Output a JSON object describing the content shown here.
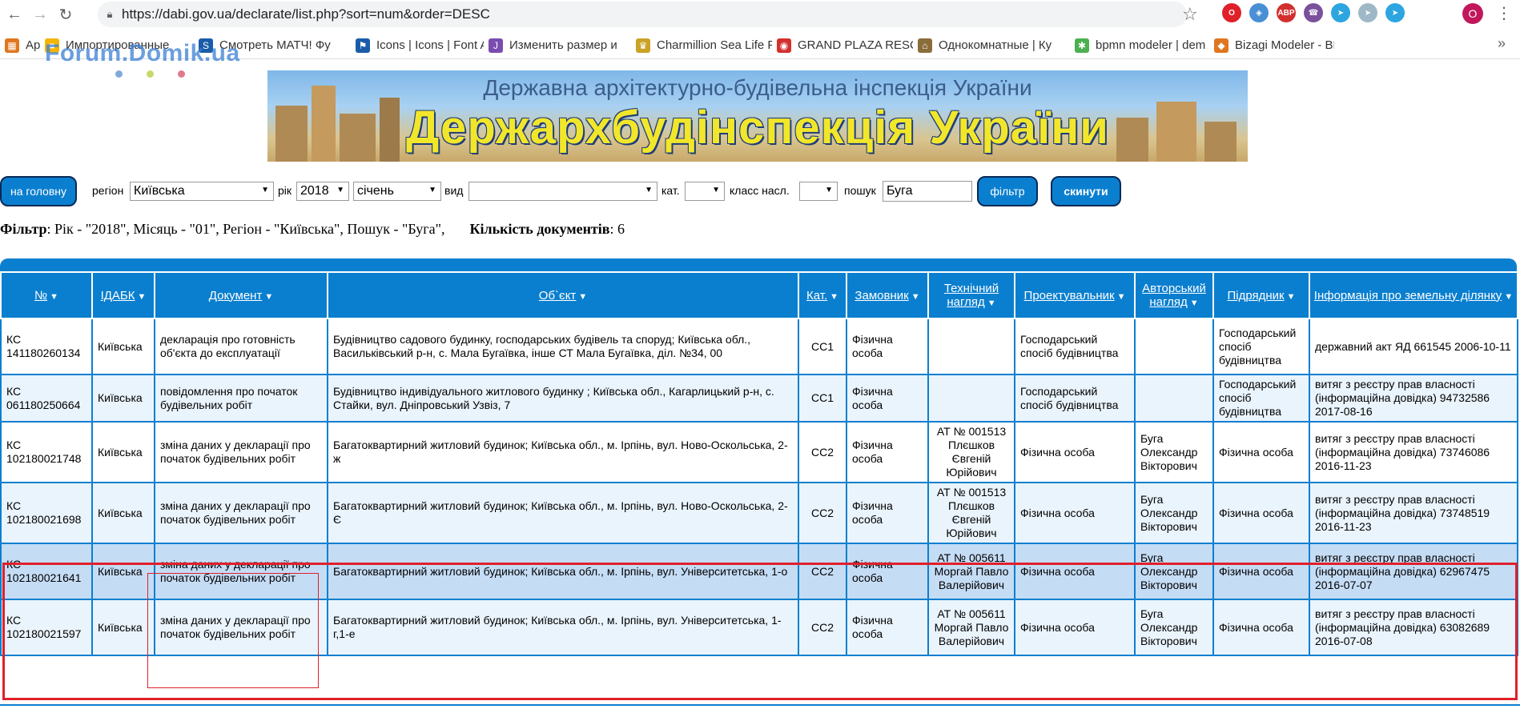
{
  "browser": {
    "url": "https://dabi.gov.ua/declarate/list.php?sort=num&order=DESC",
    "profile_initial": "O",
    "extensions": [
      {
        "name": "opera-icon",
        "color": "#e0202a",
        "label": "O"
      },
      {
        "name": "extension-icon",
        "color": "#4a8fd4",
        "label": "◈"
      },
      {
        "name": "adblock-icon",
        "color": "#d32f2f",
        "label": "ABP"
      },
      {
        "name": "viber-icon",
        "color": "#7b519d",
        "label": "☎"
      },
      {
        "name": "telegram-icon",
        "color": "#2ca5e0",
        "label": "➤"
      },
      {
        "name": "telegram-outline-icon",
        "color": "#9fb8c8",
        "label": "➤"
      },
      {
        "name": "telegram-blue-icon",
        "color": "#2ca5e0",
        "label": "➤"
      }
    ],
    "bookmarks": [
      {
        "label": "Apps",
        "icon_color": "#e0761f",
        "icon": "▦"
      },
      {
        "label": "Импортированные",
        "icon_color": "#f5b400",
        "icon": "■"
      },
      {
        "label": "Смотреть МАТЧ! Фу",
        "icon_color": "#1a5ca8",
        "icon": "S"
      },
      {
        "label": "Icons | Icons | Font A",
        "icon_color": "#1a5ca8",
        "icon": "⚑"
      },
      {
        "label": "Изменить размер и",
        "icon_color": "#7b4cb0",
        "icon": "J"
      },
      {
        "label": "Charmillion Sea Life F",
        "icon_color": "#c9a227",
        "icon": "♛"
      },
      {
        "label": "GRAND PLAZA RESO",
        "icon_color": "#d32f2f",
        "icon": "◉"
      },
      {
        "label": "Однокомнатные | Ку",
        "icon_color": "#8a6d3b",
        "icon": "⌂"
      },
      {
        "label": "bpmn modeler | dem",
        "icon_color": "#4caf50",
        "icon": "✱"
      },
      {
        "label": "Bizagi Modeler - BPM",
        "icon_color": "#e0761f",
        "icon": "◆"
      }
    ]
  },
  "watermark": "Forum.Domik.ua",
  "banner": {
    "subtitle": "Державна архітектурно-будівельна інспекція України",
    "title": "Держархбудінспекція України"
  },
  "filters": {
    "home_button": "на головну",
    "region_label": "регіон",
    "region_value": "Київська",
    "year_label": "рік",
    "year_value": "2018",
    "month_value": "січень",
    "type_label": "вид",
    "type_value": "",
    "category_label": "кат.",
    "category_value": "",
    "class_label": "класс насл.",
    "class_value": "",
    "search_label": "пошук",
    "search_value": "Буга",
    "filter_button": "фільтр",
    "reset_button": "скинути"
  },
  "summary": {
    "filter_label": "Фільтр",
    "filter_text": ": Рік - \"2018\", Місяць - \"01\", Регіон - \"Київська\", Пошук - \"Буга\",",
    "count_label": "Кількість документів",
    "count_value": ": 6"
  },
  "table": {
    "columns": [
      "№",
      "ІДАБК",
      "Документ",
      "Об`єкт",
      "Кат.",
      "Замовник",
      "Технічний нагляд",
      "Проектувальник",
      "Авторський нагляд",
      "Підрядник",
      "Інформація про земельну ділянку"
    ],
    "rows": [
      [
        "КС 141180260134",
        "Київська",
        "декларація про готовність об'єкта до експлуатації",
        "Будівництво садового будинку, господарських будівель та споруд; Київська обл., Васильківський р-н, с. Мала Бугаївка, інше СТ Мала Бугаївка, діл. №34, 00",
        "СС1",
        "Фізична особа",
        "",
        "Господарський спосіб будівництва",
        "",
        "Господарський спосіб будівництва",
        "державний акт ЯД 661545 2006-10-11"
      ],
      [
        "КС 061180250664",
        "Київська",
        "повідомлення про початок будівельних робіт",
        "Будівництво індивідуального житлового будинку ; Київська обл., Кагарлицький р-н, с. Стайки, вул. Дніпровський Узвіз, 7",
        "СС1",
        "Фізична особа",
        "",
        "Господарський спосіб будівництва",
        "",
        "Господарський спосіб будівництва",
        "витяг з реєстру прав власності (інформаційна довідка) 94732586 2017-08-16"
      ],
      [
        "КС 102180021748",
        "Київська",
        "зміна даних у декларації про початок будівельних робіт",
        "Багатоквартирний житловий будинок; Київська обл., м. Ірпінь, вул. Ново-Оскольська, 2-ж",
        "СС2",
        "Фізична особа",
        "АТ № 001513 Плєшков Євгеній Юрійович",
        "Фізична особа",
        "Буга Олександр Вікторович",
        "Фізична особа",
        "витяг з реєстру прав власності (інформаційна довідка) 73746086 2016-11-23"
      ],
      [
        "КС 102180021698",
        "Київська",
        "зміна даних у декларації про початок будівельних робіт",
        "Багатоквартирний житловий будинок; Київська обл., м. Ірпінь, вул. Ново-Оскольська, 2-Є",
        "СС2",
        "Фізична особа",
        "АТ № 001513 Плєшков Євгеній Юрійович",
        "Фізична особа",
        "Буга Олександр Вікторович",
        "Фізична особа",
        "витяг з реєстру прав власності (інформаційна довідка) 73748519 2016-11-23"
      ],
      [
        "КС 102180021641",
        "Київська",
        "зміна даних у декларації про початок будівельних робіт",
        "Багатоквартирний житловий будинок; Київська обл., м. Ірпінь, вул. Університетська, 1-о",
        "СС2",
        "Фізична особа",
        "АТ № 005611 Моргай Павло Валерійович",
        "Фізична особа",
        "Буга Олександр Вікторович",
        "Фізична особа",
        "витяг з реєстру прав власності (інформаційна довідка) 62967475 2016-07-07"
      ],
      [
        "КС 102180021597",
        "Київська",
        "зміна даних у декларації про початок будівельних робіт",
        "Багатоквартирний житловий будинок; Київська обл., м. Ірпінь, вул. Університетська, 1-г,1-е",
        "СС2",
        "Фізична особа",
        "АТ № 005611 Моргай Павло Валерійович",
        "Фізична особа",
        "Буга Олександр Вікторович",
        "Фізична особа",
        "витяг з реєстру прав власності (інформаційна довідка) 63082689 2016-07-08"
      ]
    ]
  },
  "colors": {
    "accent": "#0b7fcf",
    "highlight": "#e0202a"
  }
}
